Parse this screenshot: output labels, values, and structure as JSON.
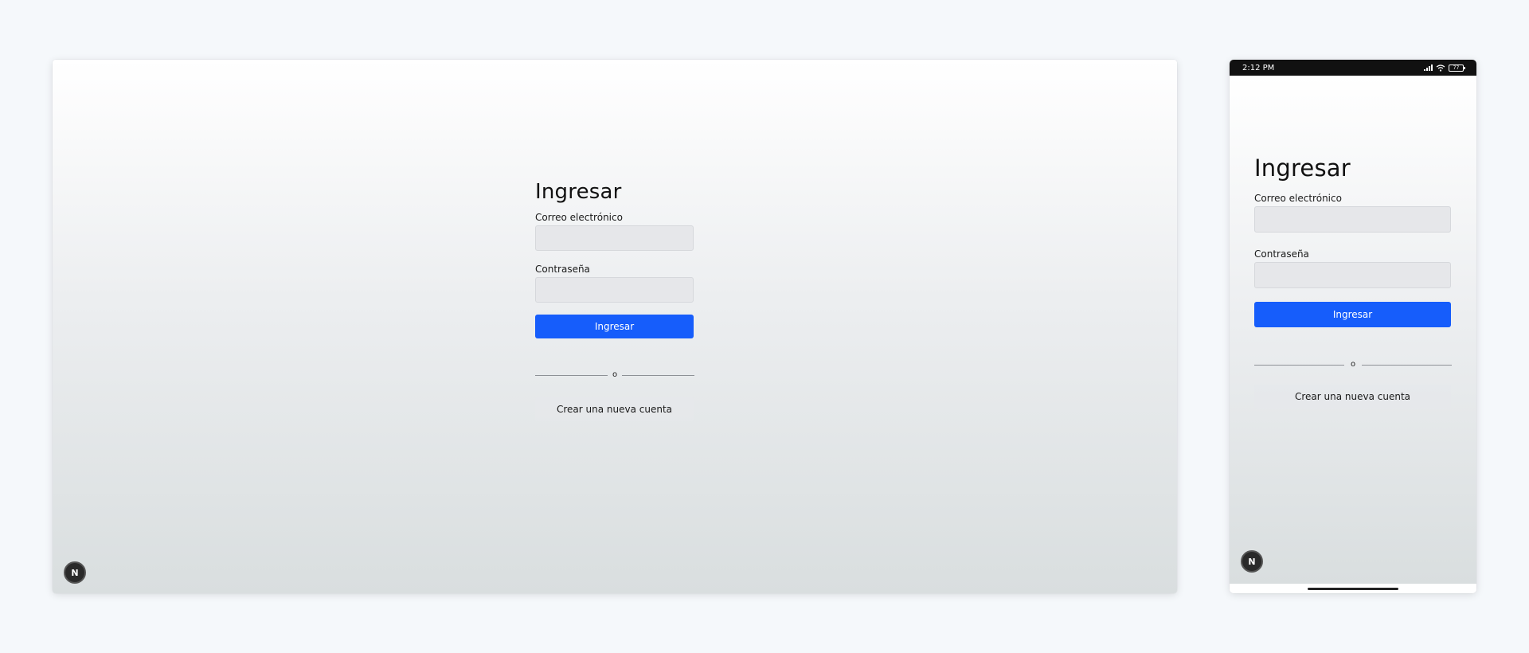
{
  "desktop": {
    "form": {
      "title": "Ingresar",
      "email_label": "Correo electrónico",
      "email_value": "",
      "password_label": "Contraseña",
      "password_value": "",
      "submit_label": "Ingresar",
      "separator_text": "o",
      "create_account_label": "Crear una nueva cuenta"
    },
    "badge_letter": "N"
  },
  "mobile": {
    "status_bar": {
      "time": "2:12 PM",
      "battery": "77"
    },
    "form": {
      "title": "Ingresar",
      "email_label": "Correo electrónico",
      "email_value": "",
      "password_label": "Contraseña",
      "password_value": "",
      "submit_label": "Ingresar",
      "separator_text": "o",
      "create_account_label": "Crear una nueva cuenta"
    },
    "badge_letter": "N"
  },
  "colors": {
    "primary": "#165dfb",
    "page_background": "#f5f8fb",
    "input_background": "#e6e7ea",
    "badge": "#2a2a2a"
  },
  "icons": {
    "badge": "nextjs-n-icon",
    "signal": "cellular-signal-icon",
    "wifi": "wifi-icon",
    "battery": "battery-icon"
  }
}
